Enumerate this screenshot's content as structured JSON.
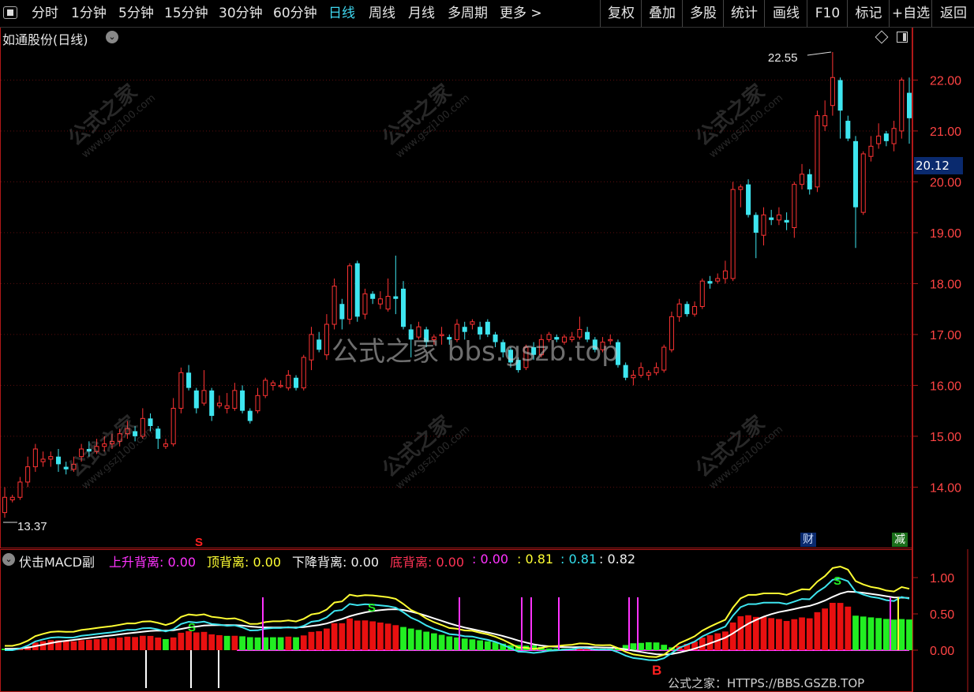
{
  "toolbar": {
    "tabs": [
      {
        "label": "分时",
        "active": false
      },
      {
        "label": "1分钟",
        "active": false
      },
      {
        "label": "5分钟",
        "active": false
      },
      {
        "label": "15分钟",
        "active": false
      },
      {
        "label": "30分钟",
        "active": false
      },
      {
        "label": "60分钟",
        "active": false
      },
      {
        "label": "日线",
        "active": true
      },
      {
        "label": "周线",
        "active": false
      },
      {
        "label": "月线",
        "active": false
      },
      {
        "label": "多周期",
        "active": false
      },
      {
        "label": "更多 >",
        "active": false
      }
    ],
    "buttons": [
      "复权",
      "叠加",
      "多股",
      "统计",
      "画线",
      "F10",
      "标记",
      "+自选",
      "返回"
    ]
  },
  "stock_title": "如通股份(日线)",
  "price_axis": {
    "ticks": [
      "22.00",
      "21.00",
      "20.00",
      "19.00",
      "18.00",
      "17.00",
      "16.00",
      "15.00",
      "14.00"
    ],
    "current_price": "20.12"
  },
  "annotations": {
    "high": "22.55",
    "low": "13.37",
    "sell_marker": "S",
    "buy_marker": "B",
    "badge_cai": "财",
    "badge_jian": "减"
  },
  "indicator": {
    "name": "伏击MACD副",
    "items": [
      {
        "label": "上升背离: 0.00",
        "color": "#ff33ff"
      },
      {
        "label": "顶背离: 0.00",
        "color": "#ffff33"
      },
      {
        "label": "下降背离: 0.00",
        "color": "#f0f0f0"
      },
      {
        "label": "底背离: 0.00",
        "color": "#ff3355"
      },
      {
        "label": ": 0.00",
        "color": "#ff33ff"
      },
      {
        "label": ": 0.81",
        "color": "#ffff33"
      },
      {
        "label": ": 0.81",
        "color": "#33e0ee"
      },
      {
        "label": ": 0.82",
        "color": "#f0f0f0"
      }
    ],
    "axis_ticks": [
      "1.00",
      "0.50",
      "0.00"
    ]
  },
  "watermarks": {
    "brand": "公式之家",
    "site": "www.gszj100.com",
    "center": "公式之家 bbs.gszb.top",
    "footer": "公式之家：HTTPS://BBS.GSZB.TOP"
  },
  "colors": {
    "up": "#ff3333",
    "down": "#3ee6f0",
    "axis": "#b01818",
    "macd_up": "#e81010",
    "macd_down": "#22ee22"
  },
  "chart_data": {
    "type": "candlestick",
    "price_range": [
      13.3,
      22.8
    ],
    "candles": [
      [
        13.5,
        13.8,
        14.0,
        13.4
      ],
      [
        13.75,
        13.8,
        13.85,
        13.7
      ],
      [
        13.8,
        14.1,
        14.2,
        13.75
      ],
      [
        14.1,
        14.4,
        14.6,
        14.0
      ],
      [
        14.4,
        14.75,
        14.85,
        14.3
      ],
      [
        14.5,
        14.55,
        14.7,
        14.4
      ],
      [
        14.55,
        14.6,
        14.7,
        14.4
      ],
      [
        14.6,
        14.45,
        14.75,
        14.3
      ],
      [
        14.4,
        14.35,
        14.5,
        14.25
      ],
      [
        14.35,
        14.45,
        14.6,
        14.3
      ],
      [
        14.6,
        14.75,
        14.85,
        14.5
      ],
      [
        14.75,
        14.7,
        14.9,
        14.6
      ],
      [
        14.7,
        14.8,
        14.95,
        14.65
      ],
      [
        14.8,
        14.85,
        15.0,
        14.7
      ],
      [
        14.85,
        14.9,
        15.05,
        14.75
      ],
      [
        14.9,
        15.05,
        15.15,
        14.8
      ],
      [
        15.05,
        15.15,
        15.3,
        14.95
      ],
      [
        15.1,
        15.0,
        15.2,
        14.9
      ],
      [
        15.0,
        15.35,
        15.55,
        14.95
      ],
      [
        15.35,
        15.2,
        15.45,
        15.1
      ],
      [
        15.15,
        14.95,
        15.2,
        14.75
      ],
      [
        14.8,
        14.85,
        14.95,
        14.75
      ],
      [
        14.85,
        15.55,
        15.75,
        14.8
      ],
      [
        15.55,
        16.25,
        16.35,
        15.45
      ],
      [
        16.25,
        15.95,
        16.4,
        15.9
      ],
      [
        15.9,
        15.55,
        15.95,
        15.45
      ],
      [
        15.65,
        15.9,
        16.3,
        15.6
      ],
      [
        15.9,
        15.4,
        15.95,
        15.3
      ],
      [
        15.6,
        15.65,
        15.8,
        15.55
      ],
      [
        15.55,
        15.6,
        15.85,
        15.45
      ],
      [
        15.55,
        15.9,
        16.05,
        15.5
      ],
      [
        15.9,
        15.5,
        16.0,
        15.45
      ],
      [
        15.5,
        15.3,
        15.55,
        15.25
      ],
      [
        15.5,
        15.8,
        15.95,
        15.45
      ],
      [
        15.8,
        16.1,
        16.15,
        15.75
      ],
      [
        16.0,
        16.05,
        16.1,
        15.9
      ],
      [
        16.0,
        16.0,
        16.1,
        15.95
      ],
      [
        15.95,
        16.2,
        16.3,
        15.9
      ],
      [
        16.15,
        15.95,
        16.2,
        15.9
      ],
      [
        15.95,
        16.55,
        16.6,
        15.9
      ],
      [
        16.5,
        17.0,
        17.15,
        16.3
      ],
      [
        16.9,
        16.7,
        17.05,
        16.65
      ],
      [
        16.6,
        17.2,
        17.4,
        16.5
      ],
      [
        17.2,
        17.95,
        18.1,
        17.1
      ],
      [
        17.6,
        17.3,
        17.7,
        17.1
      ],
      [
        17.3,
        18.35,
        18.4,
        17.2
      ],
      [
        18.4,
        17.35,
        18.45,
        17.25
      ],
      [
        17.4,
        17.8,
        17.9,
        17.3
      ],
      [
        17.8,
        17.7,
        17.85,
        17.6
      ],
      [
        17.6,
        17.7,
        17.85,
        17.5
      ],
      [
        17.5,
        17.75,
        18.1,
        17.45
      ],
      [
        17.75,
        17.7,
        18.55,
        17.4
      ],
      [
        17.9,
        17.15,
        18.05,
        17.1
      ],
      [
        17.1,
        16.9,
        17.2,
        16.55
      ],
      [
        16.95,
        17.15,
        17.25,
        16.9
      ],
      [
        17.1,
        16.85,
        17.15,
        16.75
      ],
      [
        16.9,
        16.95,
        17.0,
        16.8
      ],
      [
        17.0,
        17.0,
        17.15,
        16.8
      ],
      [
        16.95,
        16.9,
        17.0,
        16.8
      ],
      [
        16.9,
        17.2,
        17.3,
        16.85
      ],
      [
        17.15,
        17.05,
        17.25,
        16.9
      ],
      [
        17.2,
        17.25,
        17.3,
        17.1
      ],
      [
        17.15,
        17.0,
        17.25,
        16.9
      ],
      [
        17.25,
        17.0,
        17.3,
        16.95
      ],
      [
        17.0,
        16.85,
        17.05,
        16.75
      ],
      [
        16.85,
        16.65,
        16.9,
        16.55
      ],
      [
        16.7,
        16.45,
        16.75,
        16.35
      ],
      [
        16.5,
        16.3,
        16.55,
        16.25
      ],
      [
        16.35,
        16.75,
        16.8,
        16.3
      ],
      [
        16.75,
        16.6,
        16.85,
        16.5
      ],
      [
        16.6,
        16.9,
        17.0,
        16.55
      ],
      [
        16.9,
        17.0,
        17.05,
        16.85
      ],
      [
        16.95,
        16.9,
        17.0,
        16.85
      ],
      [
        16.85,
        16.95,
        17.0,
        16.8
      ],
      [
        16.9,
        16.95,
        17.05,
        16.85
      ],
      [
        16.95,
        17.1,
        17.35,
        16.9
      ],
      [
        17.05,
        16.9,
        17.15,
        16.85
      ],
      [
        16.9,
        16.7,
        16.95,
        16.65
      ],
      [
        16.7,
        16.85,
        16.95,
        16.65
      ],
      [
        16.9,
        16.9,
        17.0,
        16.8
      ],
      [
        16.85,
        16.4,
        16.9,
        16.35
      ],
      [
        16.4,
        16.15,
        16.45,
        16.1
      ],
      [
        16.15,
        16.2,
        16.3,
        16.0
      ],
      [
        16.2,
        16.35,
        16.45,
        16.15
      ],
      [
        16.2,
        16.25,
        16.3,
        16.1
      ],
      [
        16.25,
        16.35,
        16.45,
        16.2
      ],
      [
        16.3,
        16.75,
        16.8,
        16.25
      ],
      [
        16.7,
        17.35,
        17.45,
        16.65
      ],
      [
        17.35,
        17.6,
        17.7,
        17.25
      ],
      [
        17.6,
        17.4,
        17.65,
        17.35
      ],
      [
        17.4,
        17.55,
        17.65,
        17.35
      ],
      [
        17.55,
        18.05,
        18.1,
        17.5
      ],
      [
        18.05,
        18.0,
        18.15,
        17.9
      ],
      [
        18.05,
        18.1,
        18.2,
        18.0
      ],
      [
        18.1,
        18.25,
        18.45,
        18.0
      ],
      [
        18.1,
        19.85,
        20.0,
        18.05
      ],
      [
        19.85,
        19.9,
        19.95,
        19.5
      ],
      [
        19.95,
        19.35,
        20.05,
        19.3
      ],
      [
        19.35,
        19.0,
        19.4,
        18.5
      ],
      [
        18.95,
        19.35,
        19.5,
        18.75
      ],
      [
        19.3,
        19.25,
        19.45,
        19.15
      ],
      [
        19.25,
        19.35,
        19.5,
        19.15
      ],
      [
        19.25,
        19.2,
        19.4,
        19.05
      ],
      [
        19.1,
        19.95,
        20.0,
        18.9
      ],
      [
        19.95,
        20.15,
        20.35,
        19.85
      ],
      [
        20.15,
        19.85,
        20.25,
        19.75
      ],
      [
        19.9,
        21.3,
        21.4,
        19.8
      ],
      [
        21.1,
        21.3,
        21.6,
        21.0
      ],
      [
        21.5,
        22.05,
        22.55,
        21.3
      ],
      [
        22.0,
        21.4,
        22.05,
        20.85
      ],
      [
        21.2,
        20.85,
        21.3,
        20.8
      ],
      [
        20.8,
        19.5,
        20.9,
        18.7
      ],
      [
        19.4,
        20.55,
        20.6,
        19.35
      ],
      [
        20.5,
        20.7,
        20.9,
        20.4
      ],
      [
        20.75,
        20.9,
        21.15,
        20.65
      ],
      [
        20.95,
        20.8,
        21.0,
        20.7
      ],
      [
        20.75,
        21.05,
        21.2,
        20.6
      ],
      [
        21.0,
        22.0,
        22.05,
        20.85
      ],
      [
        21.75,
        21.25,
        22.05,
        20.75
      ]
    ]
  }
}
